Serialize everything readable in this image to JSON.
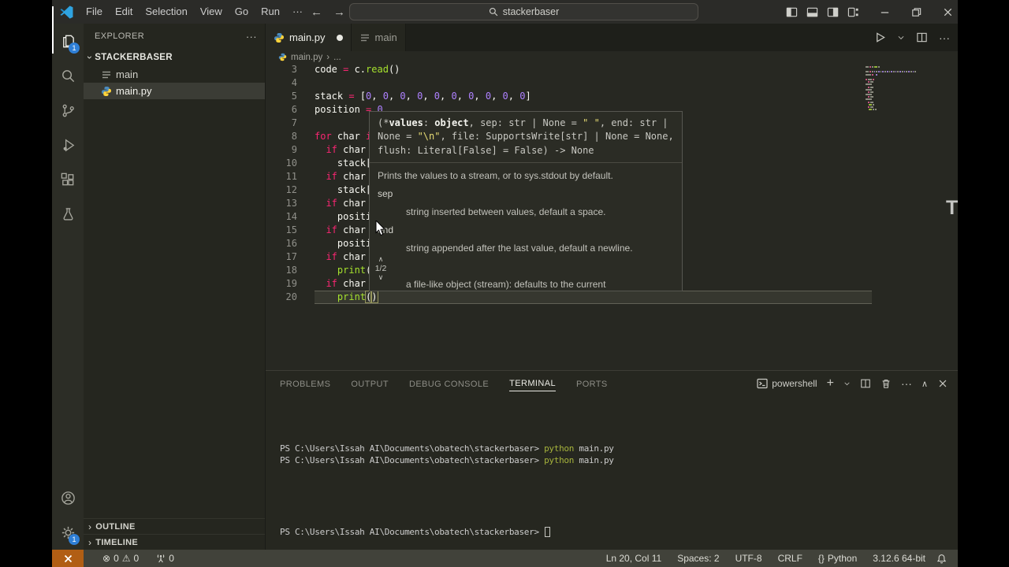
{
  "titlebar": {
    "menu_items": [
      "File",
      "Edit",
      "Selection",
      "View",
      "Go",
      "Run",
      "···"
    ],
    "search_value": "stackerbaser"
  },
  "activity_bar": {
    "explorer_badge": "1",
    "settings_badge": "1"
  },
  "sidebar": {
    "header": "EXPLORER",
    "more_label": "···",
    "root": "STACKERBASER",
    "files": [
      {
        "name": "main",
        "icon": "file",
        "selected": false
      },
      {
        "name": "main.py",
        "icon": "python",
        "selected": true
      }
    ],
    "sections": [
      {
        "label": "OUTLINE"
      },
      {
        "label": "TIMELINE"
      }
    ]
  },
  "tabs": {
    "active_label": "main.py",
    "inactive_label": "main"
  },
  "breadcrumb": {
    "file": "main.py",
    "separator": "›",
    "more": "..."
  },
  "editor": {
    "lines": [
      {
        "n": "3",
        "tokens": [
          {
            "c": "p",
            "t": "code "
          },
          {
            "c": "k",
            "t": "="
          },
          {
            "c": "p",
            "t": " c."
          },
          {
            "c": "f",
            "t": "read"
          },
          {
            "c": "p",
            "t": "()"
          }
        ]
      },
      {
        "n": "4",
        "tokens": []
      },
      {
        "n": "5",
        "tokens": [
          {
            "c": "p",
            "t": "stack "
          },
          {
            "c": "k",
            "t": "="
          },
          {
            "c": "p",
            "t": " ["
          },
          {
            "c": "n",
            "t": "0"
          },
          {
            "c": "p",
            "t": ", "
          },
          {
            "c": "n",
            "t": "0"
          },
          {
            "c": "p",
            "t": ", "
          },
          {
            "c": "n",
            "t": "0"
          },
          {
            "c": "p",
            "t": ", "
          },
          {
            "c": "n",
            "t": "0"
          },
          {
            "c": "p",
            "t": ", "
          },
          {
            "c": "n",
            "t": "0"
          },
          {
            "c": "p",
            "t": ", "
          },
          {
            "c": "n",
            "t": "0"
          },
          {
            "c": "p",
            "t": ", "
          },
          {
            "c": "n",
            "t": "0"
          },
          {
            "c": "p",
            "t": ", "
          },
          {
            "c": "n",
            "t": "0"
          },
          {
            "c": "p",
            "t": ", "
          },
          {
            "c": "n",
            "t": "0"
          },
          {
            "c": "p",
            "t": ", "
          },
          {
            "c": "n",
            "t": "0"
          },
          {
            "c": "p",
            "t": "]"
          }
        ]
      },
      {
        "n": "6",
        "tokens": [
          {
            "c": "p",
            "t": "position "
          },
          {
            "c": "k",
            "t": "="
          },
          {
            "c": "p",
            "t": " "
          },
          {
            "c": "n",
            "t": "0"
          }
        ]
      },
      {
        "n": "7",
        "tokens": []
      },
      {
        "n": "8",
        "tokens": [
          {
            "c": "k",
            "t": "for"
          },
          {
            "c": "p",
            "t": " char "
          },
          {
            "c": "k",
            "t": "i"
          }
        ]
      },
      {
        "n": "9",
        "tokens": [
          {
            "c": "p",
            "t": "  "
          },
          {
            "c": "k",
            "t": "if"
          },
          {
            "c": "p",
            "t": " char"
          }
        ]
      },
      {
        "n": "10",
        "tokens": [
          {
            "c": "p",
            "t": "    stack["
          }
        ]
      },
      {
        "n": "11",
        "tokens": [
          {
            "c": "p",
            "t": "  "
          },
          {
            "c": "k",
            "t": "if"
          },
          {
            "c": "p",
            "t": " char"
          }
        ]
      },
      {
        "n": "12",
        "tokens": [
          {
            "c": "p",
            "t": "    stack["
          }
        ]
      },
      {
        "n": "13",
        "tokens": [
          {
            "c": "p",
            "t": "  "
          },
          {
            "c": "k",
            "t": "if"
          },
          {
            "c": "p",
            "t": " char"
          }
        ]
      },
      {
        "n": "14",
        "tokens": [
          {
            "c": "p",
            "t": "    positi"
          }
        ]
      },
      {
        "n": "15",
        "tokens": [
          {
            "c": "p",
            "t": "  "
          },
          {
            "c": "k",
            "t": "if"
          },
          {
            "c": "p",
            "t": " char"
          }
        ]
      },
      {
        "n": "16",
        "tokens": [
          {
            "c": "p",
            "t": "    positi"
          }
        ]
      },
      {
        "n": "17",
        "tokens": [
          {
            "c": "p",
            "t": "  "
          },
          {
            "c": "k",
            "t": "if"
          },
          {
            "c": "p",
            "t": " char"
          }
        ]
      },
      {
        "n": "18",
        "tokens": [
          {
            "c": "p",
            "t": "    "
          },
          {
            "c": "f",
            "t": "print"
          },
          {
            "c": "p",
            "t": "("
          }
        ]
      },
      {
        "n": "19",
        "tokens": [
          {
            "c": "p",
            "t": "  "
          },
          {
            "c": "k",
            "t": "if"
          },
          {
            "c": "p",
            "t": " char"
          }
        ]
      },
      {
        "n": "20",
        "tokens": [
          {
            "c": "p",
            "t": "    "
          },
          {
            "c": "f",
            "t": "print"
          },
          {
            "c": "b",
            "t": "("
          },
          {
            "c": "b",
            "t": ")"
          }
        ]
      }
    ]
  },
  "hover": {
    "signature": [
      [
        {
          "c": "sp",
          "t": "(*"
        },
        {
          "c": "sb",
          "t": "values"
        },
        {
          "c": "sp",
          "t": ": "
        },
        {
          "c": "sb",
          "t": "object"
        },
        {
          "c": "sp",
          "t": ", sep: str | None = "
        },
        {
          "c": "ss",
          "t": "\" \""
        },
        {
          "c": "sp",
          "t": ", end: str |"
        }
      ],
      [
        {
          "c": "sp",
          "t": "None = "
        },
        {
          "c": "ss",
          "t": "\"\\n\""
        },
        {
          "c": "sp",
          "t": ", file: SupportsWrite[str] | None = None,"
        }
      ],
      [
        {
          "c": "sp",
          "t": "flush: Literal[False] = False) -> None"
        }
      ]
    ],
    "doc": "Prints the values to a stream, or to sys.stdout by default.",
    "params": [
      {
        "name": "sep",
        "desc": "string inserted between values, default a space."
      },
      {
        "name": "end",
        "desc": "string appended after the last value, default a newline."
      },
      {
        "name": "file",
        "desc": "a file-like object (stream): defaults to the current"
      }
    ],
    "pager": "1/2"
  },
  "panel": {
    "tabs": [
      {
        "label": "PROBLEMS",
        "active": false
      },
      {
        "label": "OUTPUT",
        "active": false
      },
      {
        "label": "DEBUG CONSOLE",
        "active": false
      },
      {
        "label": "TERMINAL",
        "active": true
      },
      {
        "label": "PORTS",
        "active": false
      }
    ],
    "shell": "powershell",
    "history": [
      [
        {
          "c": "t",
          "t": "PS C:\\Users\\Issah AI\\Documents\\obatech\\stackerbaser> "
        },
        {
          "c": "cmd",
          "t": "python"
        },
        {
          "c": "t",
          "t": " main.py"
        }
      ],
      [
        {
          "c": "t",
          "t": "PS C:\\Users\\Issah AI\\Documents\\obatech\\stackerbaser> "
        },
        {
          "c": "cmd",
          "t": "python"
        },
        {
          "c": "t",
          "t": " main.py"
        }
      ]
    ],
    "prompt": "PS C:\\Users\\Issah AI\\Documents\\obatech\\stackerbaser> "
  },
  "status_bar": {
    "errors": "0",
    "warnings": "0",
    "ports": "0",
    "cursor": "Ln 20, Col 11",
    "indent": "Spaces: 2",
    "encoding": "UTF-8",
    "eol": "CRLF",
    "lang_icon": "{}",
    "language": "Python",
    "interpreter": "3.12.6 64-bit"
  },
  "colors": {
    "accent_blue": "#2f7fd6",
    "remote_orange": "#b15e14",
    "keyword": "#f92672",
    "function": "#a6e22e",
    "number": "#ae81ff",
    "string": "#e6db74",
    "editor_bg": "#272822"
  },
  "artifact": {
    "text": "T"
  }
}
